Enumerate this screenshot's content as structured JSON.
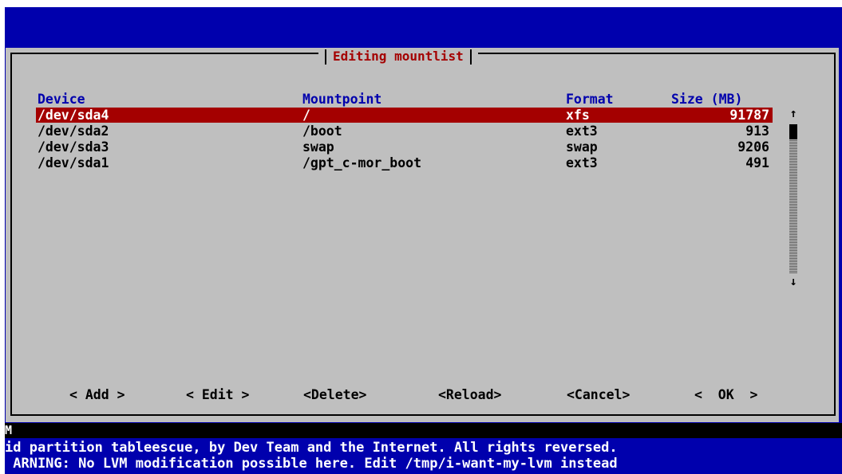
{
  "dialog": {
    "title": "Editing mountlist",
    "columns": {
      "device": "Device",
      "mountpoint": "Mountpoint",
      "format": "Format",
      "size": "Size (MB)"
    },
    "rows": [
      {
        "device": "/dev/sda4",
        "mountpoint": "/",
        "format": "xfs",
        "size": "91787",
        "selected": true
      },
      {
        "device": "/dev/sda2",
        "mountpoint": "/boot",
        "format": "ext3",
        "size": "913",
        "selected": false
      },
      {
        "device": "/dev/sda3",
        "mountpoint": "swap",
        "format": "swap",
        "size": "9206",
        "selected": false
      },
      {
        "device": "/dev/sda1",
        "mountpoint": "/gpt_c-mor_boot",
        "format": "ext3",
        "size": "491",
        "selected": false
      }
    ],
    "scrollbar": {
      "up_arrow": "↑",
      "down_arrow": "↓"
    },
    "buttons": {
      "add": "< Add >",
      "edit": "< Edit >",
      "delete": "<Delete>",
      "reload": "<Reload>",
      "cancel": "<Cancel>",
      "ok": "<  OK  >"
    }
  },
  "command_line": {
    "cursor_text": "M"
  },
  "status_lines": {
    "line1": "id partition tableescue, by Dev Team and the Internet. All rights reversed.",
    "line2": " ARNING: No LVM modification possible here. Edit /tmp/i-want-my-lvm instead"
  },
  "colors": {
    "screen_background": "#0000ad",
    "dialog_background": "#bfbfbf",
    "title_color": "#a40000",
    "header_color": "#0000ad",
    "selection_background": "#a40000",
    "status_text": "#ffffff"
  }
}
